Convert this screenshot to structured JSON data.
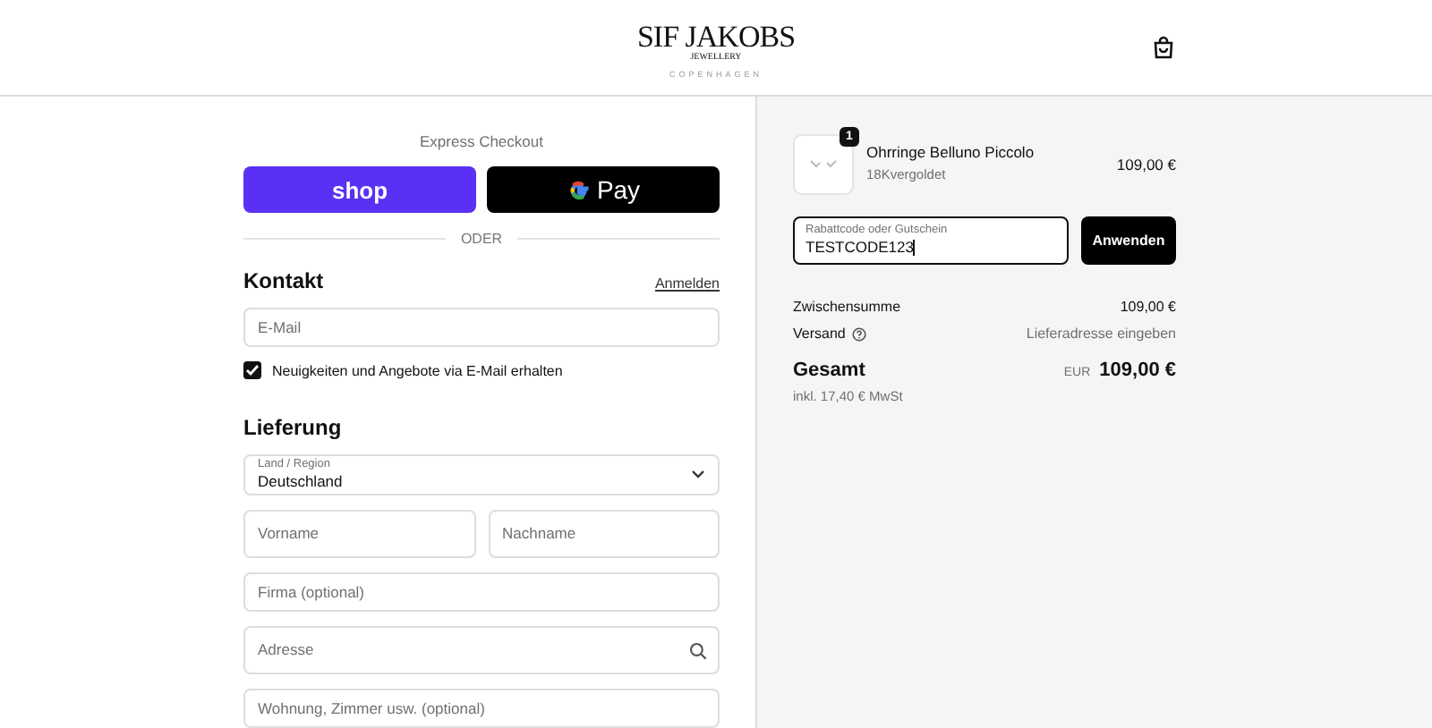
{
  "header": {
    "logo": {
      "name": "SIF JAKOBS",
      "line_2": "JEWELLERY",
      "line_3": "COPENHAGEN"
    }
  },
  "express_checkout": {
    "title": "Express Checkout",
    "buttons": [
      {
        "kind": "shop",
        "label": "shop"
      },
      {
        "kind": "gpay",
        "label": "Pay"
      }
    ],
    "divider": "ODER"
  },
  "contact": {
    "title": "Kontakt",
    "login_link": "Anmelden",
    "email": {
      "placeholder": "E-Mail"
    },
    "newsletter": {
      "label": "Neuigkeiten und Angebote via E-Mail erhalten",
      "checked": true
    }
  },
  "delivery": {
    "title": "Lieferung",
    "country": {
      "label": "Land / Region",
      "value": "Deutschland"
    },
    "first_name": {
      "placeholder": "Vorname"
    },
    "last_name": {
      "placeholder": "Nachname"
    },
    "company": {
      "placeholder": "Firma (optional)"
    },
    "address": {
      "placeholder": "Adresse"
    },
    "apartment": {
      "placeholder": "Wohnung, Zimmer usw. (optional)"
    }
  },
  "summary": {
    "item": {
      "quantity": "1",
      "name": "Ohrringe Belluno Piccolo",
      "variant": "18Kvergoldet",
      "price": "109,00 €"
    },
    "discount": {
      "label": "Rabattcode oder Gutschein",
      "value": "TESTCODE123",
      "button": "Anwenden"
    },
    "subtotal": {
      "label": "Zwischensumme",
      "value": "109,00 €"
    },
    "shipping": {
      "label": "Versand",
      "value": "Lieferadresse eingeben"
    },
    "total": {
      "label": "Gesamt",
      "currency": "EUR",
      "value": "109,00 €",
      "tax": "inkl. 17,40 € MwSt"
    }
  }
}
